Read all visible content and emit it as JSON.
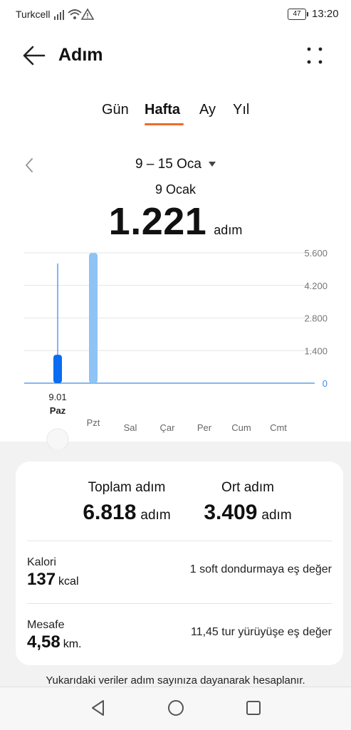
{
  "status_bar": {
    "carrier": "Turkcell",
    "battery": "47",
    "time": "13:20"
  },
  "appbar": {
    "title": "Adım",
    "back_icon": "arrow-left-icon",
    "more_icon": "more-dots-icon"
  },
  "tabs": [
    {
      "label": "Gün",
      "active": false
    },
    {
      "label": "Hafta",
      "active": true
    },
    {
      "label": "Ay",
      "active": false
    },
    {
      "label": "Yıl",
      "active": false
    }
  ],
  "range": {
    "label": "9 – 15 Oca"
  },
  "selected": {
    "date": "9 Ocak",
    "value": "1.221",
    "unit": "adım"
  },
  "chart_data": {
    "type": "bar",
    "categories": [
      "Paz",
      "Pzt",
      "Sal",
      "Çar",
      "Per",
      "Cum",
      "Cmt"
    ],
    "values": [
      1221,
      5597,
      0,
      0,
      0,
      0,
      0
    ],
    "ylim": [
      0,
      5600
    ],
    "yticks": [
      "0",
      "1.400",
      "2.800",
      "4.200",
      "5.600"
    ],
    "selected_index": 0,
    "selected_date_label": "9.01",
    "colors": {
      "selected": "#0a6cf0",
      "normal": "#8ec3f5",
      "grid": "#e6e6e6",
      "axis": "#3a8ee6"
    }
  },
  "summary": {
    "total_label": "Toplam adım",
    "total_value": "6.818",
    "total_unit": "adım",
    "avg_label": "Ort adım",
    "avg_value": "3.409",
    "avg_unit": "adım",
    "calorie_label": "Kalori",
    "calorie_value": "137",
    "calorie_unit": "kcal",
    "calorie_equiv": "1 soft dondurmaya eş değer",
    "distance_label": "Mesafe",
    "distance_value": "4,58",
    "distance_unit": "km.",
    "distance_equiv": "11,45 tur yürüyüşe eş değer"
  },
  "footnote": "Yukarıdaki veriler adım sayınıza dayanarak hesaplanır.",
  "nav": {
    "back_icon": "nav-back-icon",
    "home_icon": "nav-home-icon",
    "recents_icon": "nav-recents-icon"
  }
}
